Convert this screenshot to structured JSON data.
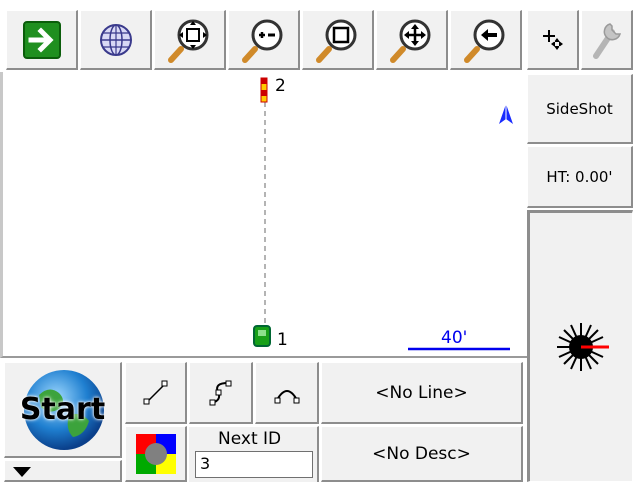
{
  "toolbar": {
    "buttons": [
      {
        "name": "exit-button",
        "icon": "green-arrow-icon"
      },
      {
        "name": "globe-view-button",
        "icon": "globe-icon"
      },
      {
        "name": "zoom-extents-button",
        "icon": "zoom-extents-icon"
      },
      {
        "name": "zoom-out-button",
        "icon": "zoom-out-icon"
      },
      {
        "name": "zoom-window-button",
        "icon": "zoom-window-icon"
      },
      {
        "name": "pan-button",
        "icon": "pan-icon"
      },
      {
        "name": "zoom-previous-button",
        "icon": "zoom-previous-icon"
      },
      {
        "name": "crosshair-button",
        "icon": "crosshair-icon"
      },
      {
        "name": "tools-button",
        "icon": "wrench-icon"
      }
    ]
  },
  "map": {
    "point_top_label": "2",
    "point_bottom_label": "1",
    "scale_label": "40'",
    "north_icon": "north-arrow-icon"
  },
  "side": {
    "sideshot_label": "SideShot",
    "height_label": "HT: 0.00'",
    "target_icon": "target-starburst-icon"
  },
  "bottom": {
    "start_label": "Start",
    "line_label": "<No Line>",
    "desc_label": "<No Desc>",
    "next_id_label": "Next ID",
    "next_id_value": "3",
    "colors": {
      "accent_green": "#1f8f1f",
      "line_blue": "#0000ff",
      "start_text": "#000000"
    }
  }
}
